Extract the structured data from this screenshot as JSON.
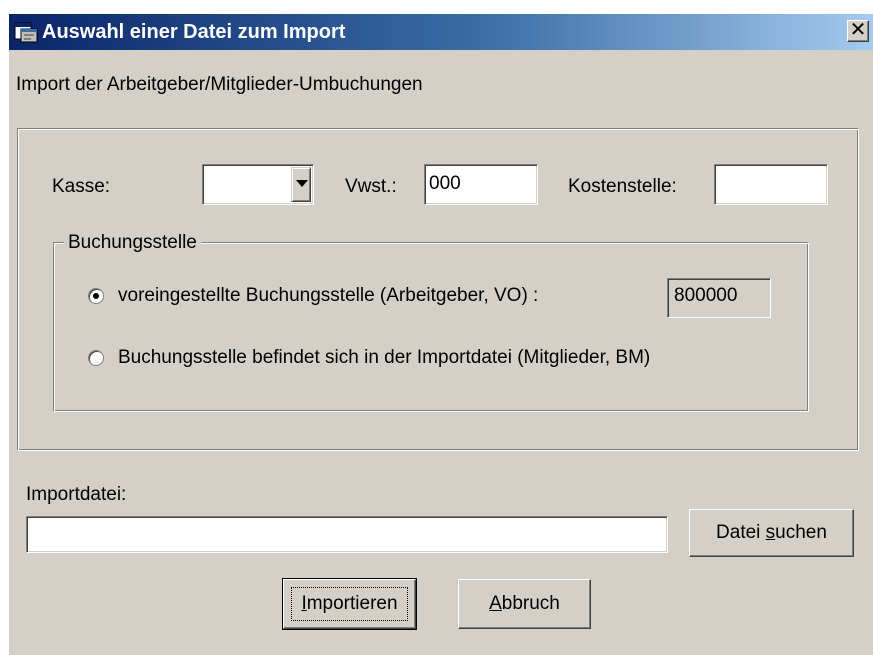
{
  "window": {
    "title": "Auswahl einer Datei zum Import",
    "close_glyph": "✕"
  },
  "header_label": "Import der Arbeitgeber/Mitglieder-Umbuchungen",
  "kasse": {
    "label": "Kasse:",
    "value": ""
  },
  "vwst": {
    "label": "Vwst.:",
    "value": "000"
  },
  "kostenstelle": {
    "label": "Kostenstelle:",
    "value": ""
  },
  "buchungsstelle": {
    "legend": "Buchungsstelle",
    "option1": {
      "label": "voreingestellte Buchungsstelle (Arbeitgeber, VO) :",
      "selected": true,
      "value": "800000"
    },
    "option2": {
      "label": "Buchungsstelle befindet sich in der Importdatei (Mitglieder, BM)",
      "selected": false
    }
  },
  "importdatei": {
    "label": "Importdatei:",
    "value": ""
  },
  "buttons": {
    "search": {
      "pre": "Datei ",
      "accel": "s",
      "post": "uchen"
    },
    "import": {
      "pre": "",
      "accel": "I",
      "post": "mportieren"
    },
    "cancel": {
      "pre": "",
      "accel": "A",
      "post": "bbruch"
    }
  },
  "icons": {
    "app": "import-window-icon",
    "close": "close-icon",
    "dropdown": "chevron-down-icon"
  }
}
